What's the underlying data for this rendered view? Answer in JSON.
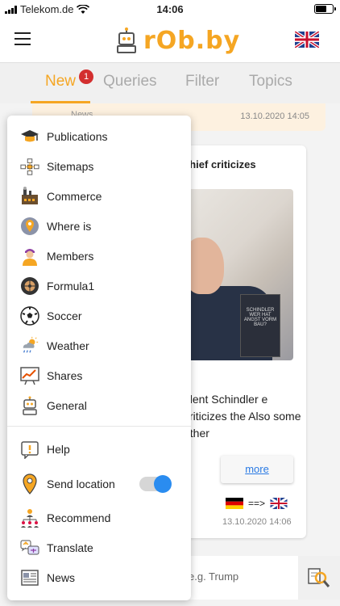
{
  "status": {
    "carrier": "Telekom.de",
    "time": "14:06"
  },
  "header": {
    "logo_text": "rOb.by"
  },
  "tabs": [
    {
      "label": "New",
      "badge": "1"
    },
    {
      "label": "Queries"
    },
    {
      "label": "Filter"
    },
    {
      "label": "Topics"
    }
  ],
  "news_strip": {
    "label": "News",
    "date": "13.10.2020 14:05"
  },
  "card": {
    "title": "chief criticizes",
    "body": "ident Schindler e criticizes the Also some other",
    "more": "more",
    "arrow": "==>",
    "date": "13.10.2020 14:06",
    "book_text": "SCHINDLER WER HAT ANGST VORM BAU?"
  },
  "search": {
    "placeholder": "e.g. Trump"
  },
  "menu": {
    "topics": [
      {
        "label": "Publications",
        "icon": "graduation-cap-icon"
      },
      {
        "label": "Sitemaps",
        "icon": "sitemap-icon"
      },
      {
        "label": "Commerce",
        "icon": "factory-icon"
      },
      {
        "label": "Where is",
        "icon": "map-pin-icon"
      },
      {
        "label": "Members",
        "icon": "member-icon"
      },
      {
        "label": "Formula1",
        "icon": "tire-icon"
      },
      {
        "label": "Soccer",
        "icon": "soccer-ball-icon"
      },
      {
        "label": "Weather",
        "icon": "weather-icon"
      },
      {
        "label": "Shares",
        "icon": "shares-chart-icon"
      },
      {
        "label": "General",
        "icon": "robot-icon"
      }
    ],
    "tools": [
      {
        "label": "Help",
        "icon": "help-icon"
      },
      {
        "label": "Send location",
        "icon": "location-pin-icon",
        "toggle": true
      },
      {
        "label": "Recommend",
        "icon": "recommend-icon"
      },
      {
        "label": "Translate",
        "icon": "translate-icon"
      },
      {
        "label": "News",
        "icon": "newspaper-icon"
      }
    ],
    "send_location_on": true
  },
  "colors": {
    "accent": "#f5a623",
    "toggle_on": "#2a8cf0",
    "badge": "#d32f2f"
  }
}
